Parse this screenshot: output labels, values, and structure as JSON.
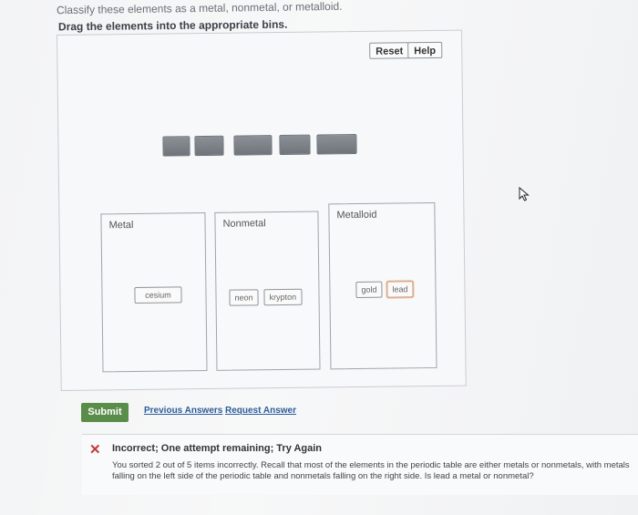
{
  "header": {
    "instruction": "Classify these elements as a metal, nonmetal, or metalloid.",
    "drag_title": "Drag the elements into the appropriate bins."
  },
  "toolbar": {
    "reset_label": "Reset",
    "help_label": "Help"
  },
  "bins": [
    {
      "label": "Metal",
      "items": [
        "cesium"
      ]
    },
    {
      "label": "Nonmetal",
      "items": [
        "neon",
        "krypton"
      ]
    },
    {
      "label": "Metalloid",
      "items": [
        "gold",
        "lead"
      ]
    }
  ],
  "actions": {
    "submit_label": "Submit",
    "previous_answers_label": "Previous Answers",
    "request_answer_label": "Request Answer"
  },
  "feedback": {
    "title": "Incorrect; One attempt remaining; Try Again",
    "body": "You sorted 2 out of 5 items incorrectly. Recall that most of the elements in the periodic table are either metals or nonmetals, with metals falling on the left side of the periodic table and nonmetals falling on the right side. Is lead a metal or nonmetal?"
  },
  "colors": {
    "submit": "#5a8d49",
    "error": "#c33b30",
    "link": "#2d5c9a"
  }
}
